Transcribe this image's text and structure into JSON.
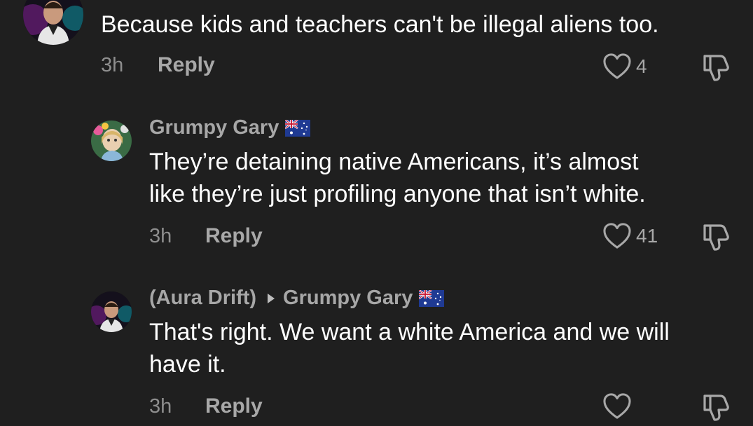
{
  "comments": [
    {
      "author": "",
      "text_lines": [
        "Because kids and teachers can't be illegal aliens too."
      ],
      "time": "3h",
      "reply_label": "Reply",
      "likes": "4"
    },
    {
      "author": "Grumpy Gary",
      "author_flag": "australia-flag-icon",
      "text_lines": [
        "They’re detaining native Americans, it’s almost",
        "like they’re just profiling anyone that isn’t white."
      ],
      "time": "3h",
      "reply_label": "Reply",
      "likes": "41"
    },
    {
      "author": "(Aura Drift)",
      "reply_to": "Grumpy Gary",
      "reply_to_flag": "australia-flag-icon",
      "text_lines": [
        "That's right. We want a white America and we will",
        "have it."
      ],
      "time": "3h",
      "reply_label": "Reply",
      "likes": ""
    }
  ],
  "colors": {
    "background": "#1f1f1f",
    "text": "#ffffff",
    "muted": "#a8a8a8"
  }
}
